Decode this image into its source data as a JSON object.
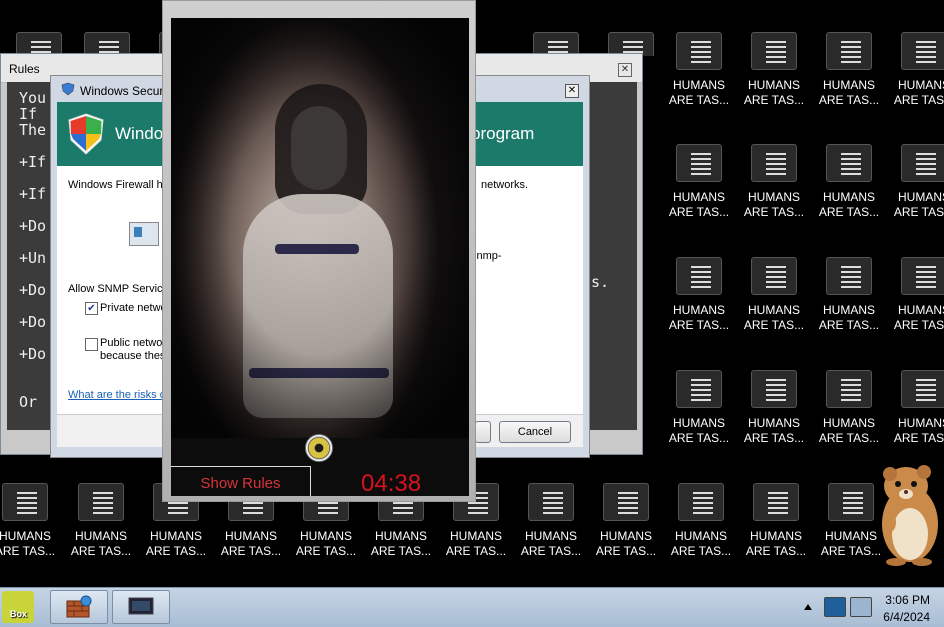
{
  "desktop": {
    "icon_label": "HUMANS\nARE TAS..."
  },
  "rules_window": {
    "title": "Rules",
    "lines": [
      "You",
      "If",
      "The",
      "+If",
      "+If",
      "+Do",
      "+Un",
      "+Do",
      "+Do",
      "+Do",
      "Or"
    ],
    "right_text": "s."
  },
  "security_dialog": {
    "title": "Windows Securi",
    "banner_left": "Windo",
    "banner_right": "program",
    "intro_left": "Windows Firewall ha",
    "intro_right": "networks.",
    "snmp_fragment": "snmp-",
    "allow_label": "Allow SNMP Service",
    "private_label": "Private netwo",
    "private_checked": true,
    "public_label": "Public networ",
    "public_sub": "because thes",
    "public_checked": false,
    "risk_link": "What are the risks o",
    "cancel_label": "Cancel"
  },
  "popup": {
    "show_rules_label": "Show Rules",
    "timer": "04:38"
  },
  "taskbar": {
    "start_label": "Box",
    "time": "3:06 PM",
    "date": "6/4/2024"
  }
}
